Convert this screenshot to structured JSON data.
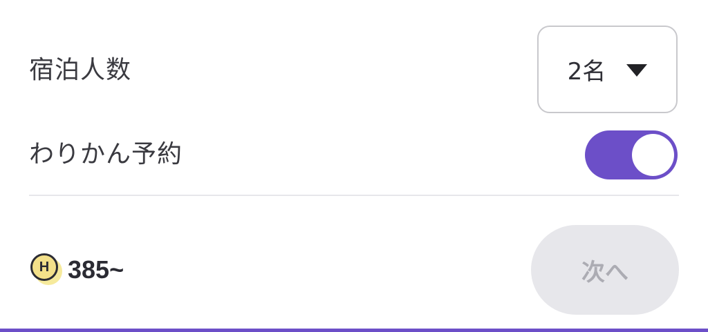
{
  "guests": {
    "label": "宿泊人数",
    "selected": "2名"
  },
  "split_booking": {
    "label": "わりかん予約",
    "enabled": true
  },
  "price": {
    "coin_letter": "H",
    "value": "385~"
  },
  "next_button": {
    "label": "次へ",
    "disabled": true
  },
  "colors": {
    "accent": "#6c4fc8",
    "button_disabled_bg": "#e7e7eb",
    "button_disabled_text": "#acacb3",
    "coin_yellow": "#f3e08a",
    "coin_shadow": "#f6ea9c"
  },
  "icons": {
    "dropdown": "caret-down-icon",
    "coin": "h-coin-icon"
  }
}
